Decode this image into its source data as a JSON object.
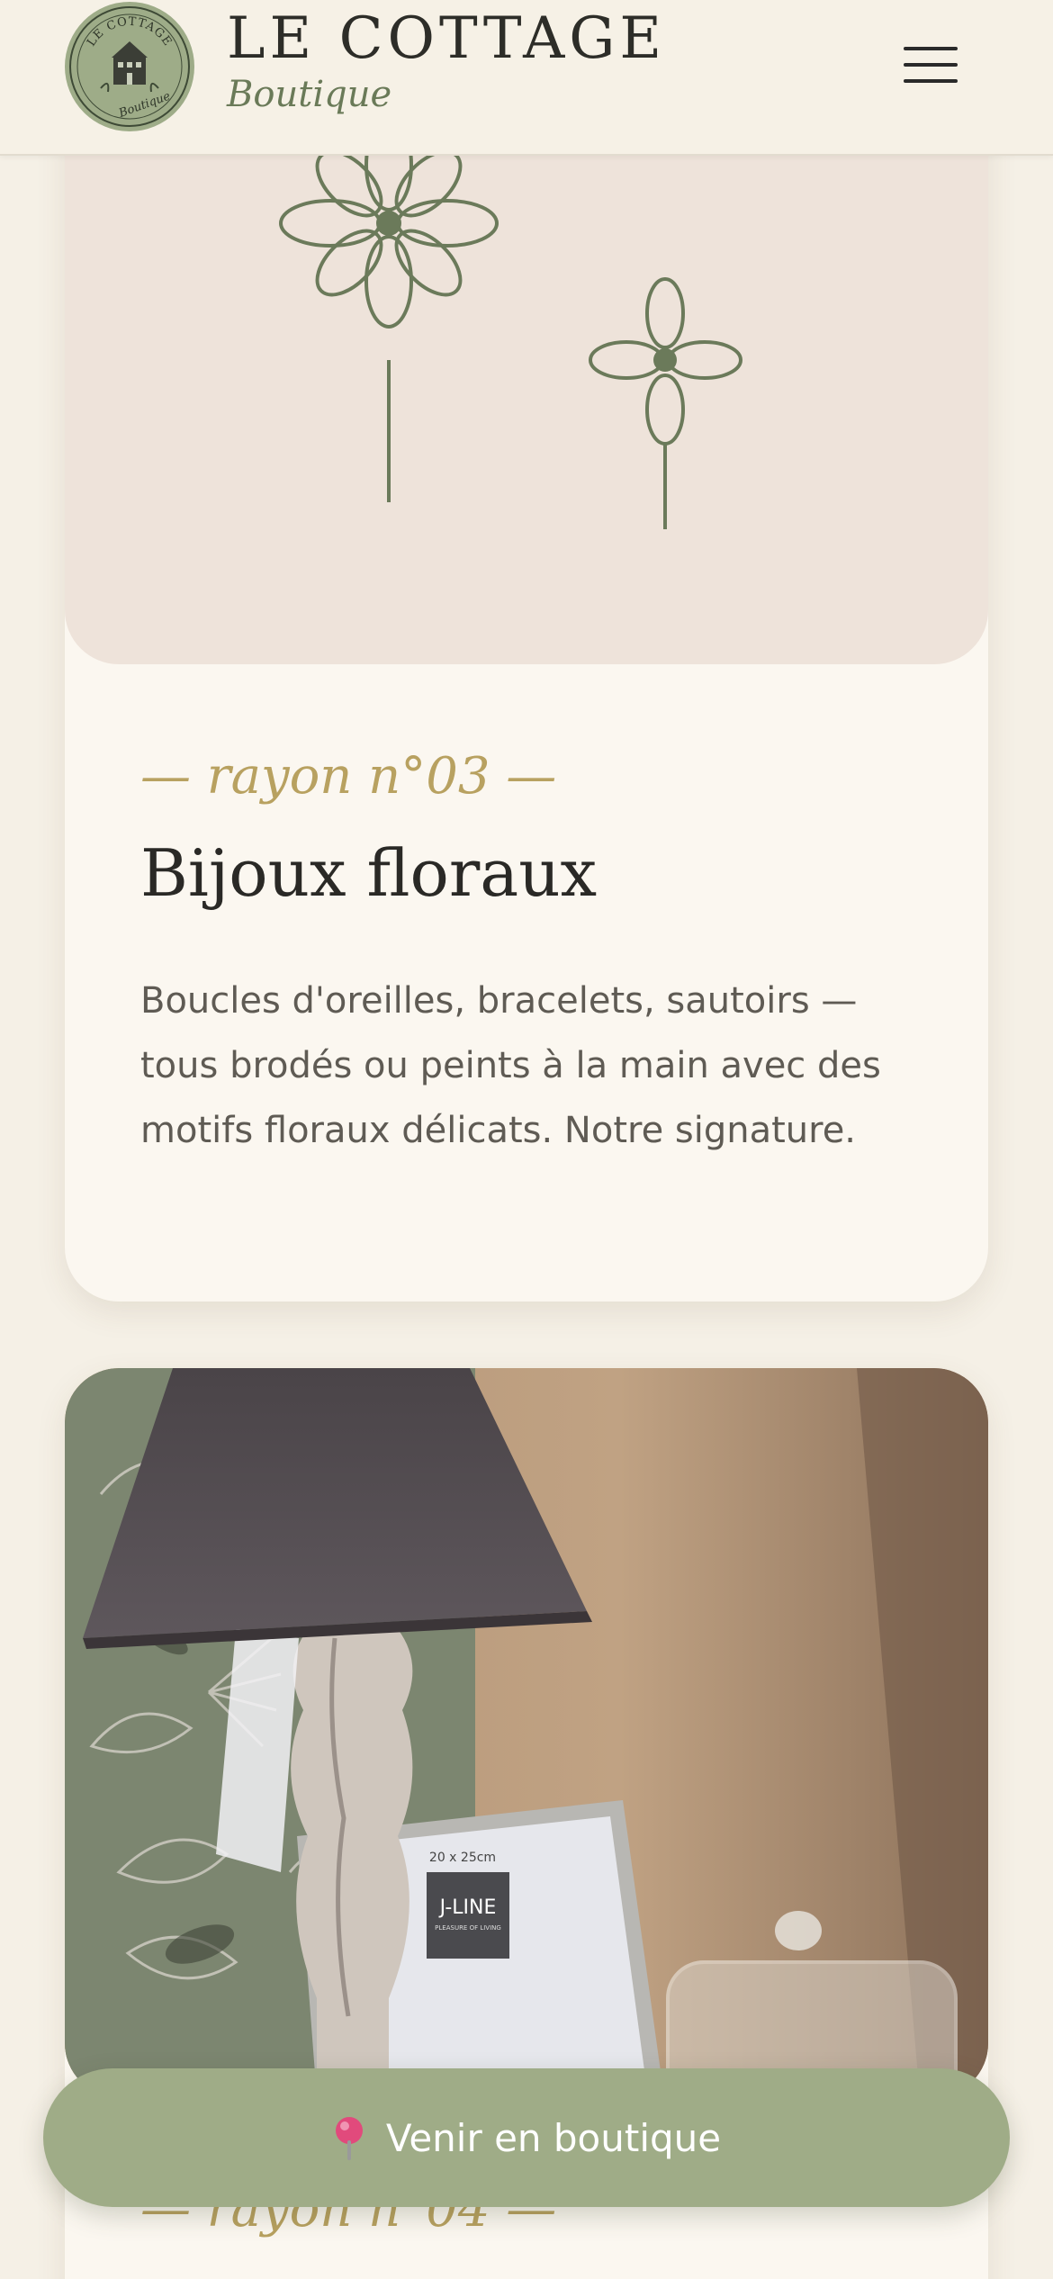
{
  "header": {
    "brand_title": "LE COTTAGE",
    "brand_subtitle": "Boutique",
    "logo_text_top": "LE COTTAGE",
    "logo_text_bottom": "Boutique",
    "menu_icon": "hamburger-icon"
  },
  "sections": [
    {
      "kicker": "— rayon n°03 —",
      "title": "Bijoux floraux",
      "description": "Boucles d'oreilles, bracelets, sautoirs — tous brodés ou peints à la main avec des motifs floraux délicats. Notre signature.",
      "illustration": "flower-illustration"
    },
    {
      "kicker": "— rayon n°04 —",
      "photo": "lamp-and-frame-photo",
      "frame_size_label": "20 x 25cm",
      "frame_brand": "J-LINE",
      "frame_brand_tagline": "PLEASURE OF LIVING"
    }
  ],
  "cta": {
    "label": "Venir en boutique",
    "icon": "map-pin-icon"
  },
  "colors": {
    "background": "#f5f0e6",
    "card": "#fbf7f0",
    "illustration_bg": "#eee3da",
    "sage": "#9fac87",
    "line_green": "#6b7a5a",
    "gold": "#b8a160",
    "title": "#2a2926",
    "body_text": "#5f5b54"
  }
}
